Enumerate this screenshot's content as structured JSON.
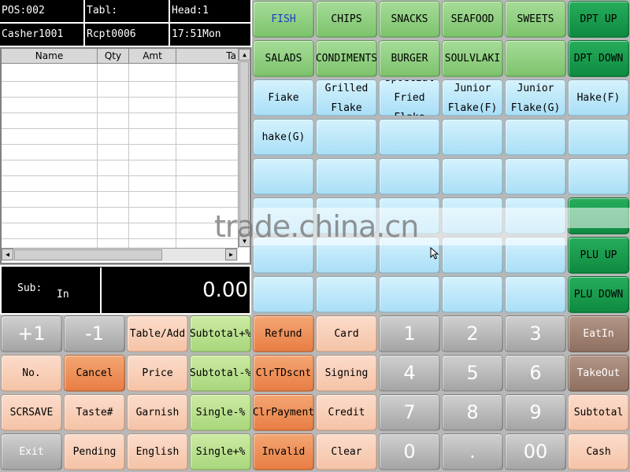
{
  "header": {
    "pos": "POS:002",
    "table": "Tabl:",
    "head": "Head:1",
    "cashier": "Casher1001",
    "receipt": "Rcpt0006",
    "time": "17:51Mon"
  },
  "grid": {
    "columns": [
      "Name",
      "Qty",
      "Amt",
      "Ta"
    ],
    "rows": []
  },
  "subtotal": {
    "label": "Sub:",
    "mode": "In",
    "value": "0.00"
  },
  "departments": [
    "FISH",
    "CHIPS",
    "SNACKS",
    "SEAFOOD",
    "SWEETS",
    "SALADS",
    "CONDIMENTS",
    "BURGER",
    "SOULVLAKI",
    ""
  ],
  "dept_nav": {
    "up": "DPT UP",
    "down": "DPT DOWN"
  },
  "plu": {
    "items": [
      "Fiake",
      "Grilled Flake",
      "Spoecial Fried Flake",
      "Junior Flake(F)",
      "Junior Flake(G)",
      "Hake(F)",
      "hake(G)"
    ],
    "up": "PLU UP",
    "down": "PLU DOWN"
  },
  "functions": {
    "row1": [
      "+1",
      "-1",
      "Table/Add",
      "Subtotal+%",
      "Refund",
      "Card"
    ],
    "row2": [
      "No.",
      "Cancel",
      "Price",
      "Subtotal-%",
      "ClrTDscnt",
      "Signing"
    ],
    "row3": [
      "SCRSAVE",
      "Taste#",
      "Garnish",
      "Single-%",
      "ClrPayment",
      "Credit"
    ],
    "row4": [
      "Exit",
      "Pending",
      "English",
      "Single+%",
      "Invalid",
      "Clear"
    ]
  },
  "keypad": [
    "1",
    "2",
    "3",
    "4",
    "5",
    "6",
    "7",
    "8",
    "9",
    "0",
    ".",
    "00"
  ],
  "right_actions": [
    "EatIn",
    "TakeOut",
    "Subtotal",
    "Cash"
  ],
  "watermark": "trade.china.cn",
  "colors": {
    "department": "#8fd17f",
    "nav": "#109347",
    "plu": "#b5e4f8",
    "function_peach": "#f8d0b8",
    "function_orange": "#ee8f58",
    "function_green": "#bde29a",
    "keypad": "#b8b8b8",
    "order_type": "#9b7e70"
  }
}
